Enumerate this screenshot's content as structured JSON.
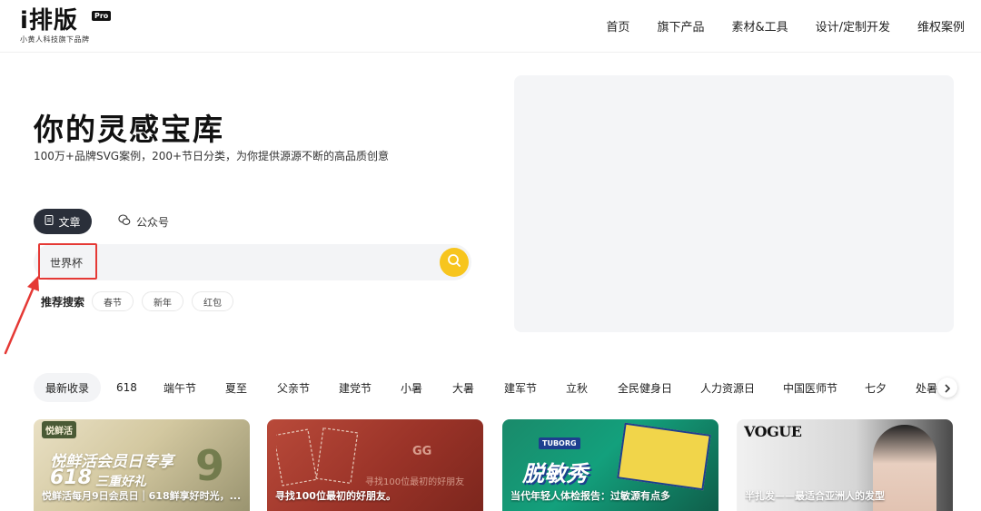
{
  "header": {
    "logo": "i排版",
    "logo_badge": "Pro",
    "logo_sub": "小黄人科技旗下品牌",
    "nav": [
      "首页",
      "旗下产品",
      "素材&工具",
      "设计/定制开发",
      "维权案例"
    ]
  },
  "hero": {
    "title": "你的灵感宝库",
    "subtitle": "100万+品牌SVG案例，200+节日分类，为你提供源源不断的高品质创意"
  },
  "search": {
    "tabs": [
      "文章",
      "公众号"
    ],
    "active_tab": "文章",
    "value": "世界杯",
    "recommend_label": "推荐搜索",
    "recommend_tags": [
      "春节",
      "新年",
      "红包"
    ]
  },
  "categories": [
    "最新收录",
    "618",
    "端午节",
    "夏至",
    "父亲节",
    "建党节",
    "小暑",
    "大暑",
    "建军节",
    "立秋",
    "全民健身日",
    "人力资源日",
    "中国医师节",
    "七夕",
    "处暑"
  ],
  "cards": [
    {
      "title": "悦鲜活每月9日会员日｜618鲜享好时光，...",
      "deco_brand": "悦鲜活",
      "deco_line1": "悦鲜活会员日专享",
      "deco_line2": "618",
      "deco_line3": "三重好礼",
      "deco_num": "9"
    },
    {
      "title": "寻找100位最初的好朋友。",
      "deco_line1": "寻找100位最初的好朋友",
      "deco_mark": "GG"
    },
    {
      "title": "当代年轻人体检报告：过敏源有点多",
      "deco_brand": "TUBORG",
      "deco_line1": "脱敏秀"
    },
    {
      "title": "半扎发——最适合亚洲人的发型",
      "deco_brand": "VOGUE"
    }
  ],
  "colors": {
    "accent": "#f7c51e",
    "tab_active_bg": "#2a2f3a",
    "highlight": "#e53935"
  }
}
